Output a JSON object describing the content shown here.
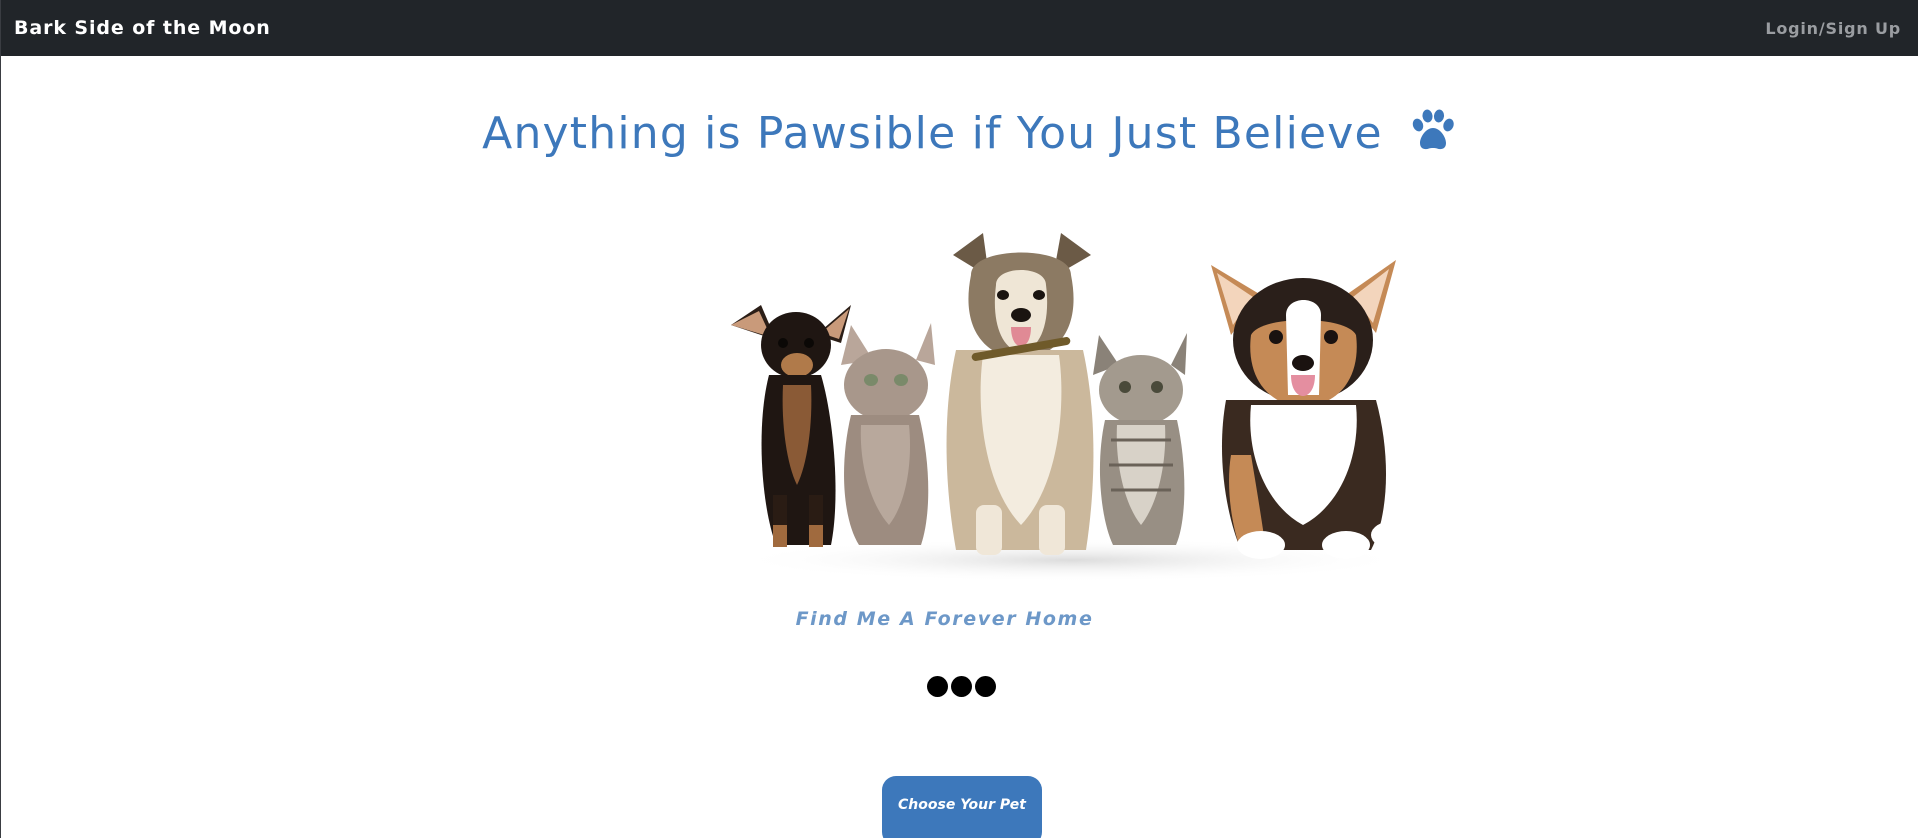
{
  "navbar": {
    "brand": "Bark Side of the Moon",
    "login_link": "Login/Sign Up"
  },
  "hero": {
    "title": "Anything is Pawsible if You Just Believe",
    "title_icon": "paw-icon",
    "image_alt": "Group of dogs and cats sitting together",
    "tagline": "Find Me A Forever Home"
  },
  "carousel": {
    "dot_count": 3
  },
  "cta": {
    "label": "Choose Your Pet"
  },
  "colors": {
    "navbar_bg": "#212529",
    "accent": "#3d78bb",
    "tagline": "#6d98c8",
    "nav_link": "#9a9da1"
  }
}
